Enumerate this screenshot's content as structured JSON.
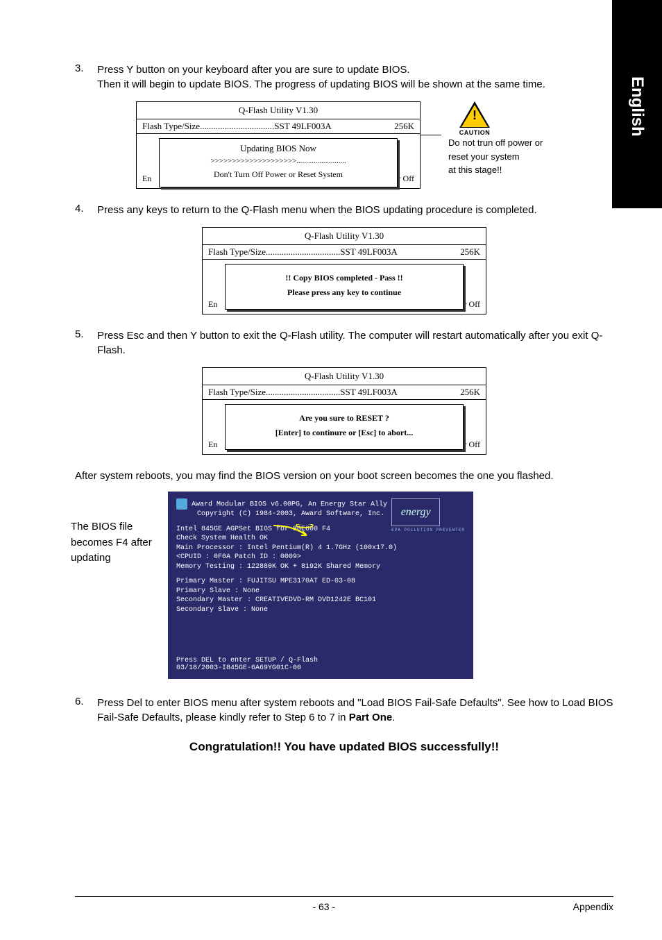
{
  "sideTab": "English",
  "steps": {
    "s3": {
      "num": "3.",
      "text1": "Press Y button on your keyboard after you are sure to update BIOS.",
      "text2": "Then it will begin to update BIOS. The progress of updating BIOS will be shown at the same time."
    },
    "s4": {
      "num": "4.",
      "text": "Press any keys to return to the Q-Flash menu when the BIOS updating procedure is completed."
    },
    "s5": {
      "num": "5.",
      "text": "Press Esc and then Y button to exit the Q-Flash utility. The computer will restart automatically after you exit Q-Flash."
    },
    "s6": {
      "num": "6.",
      "text1": "Press Del to enter BIOS menu after system reboots and \"Load BIOS Fail-Safe Defaults\". See how to Load BIOS Fail-Safe Defaults, please kindly refer to Step 6 to 7 in ",
      "partOne": "Part One",
      "tail": "."
    }
  },
  "qflash": {
    "title": "Q-Flash Utility V1.30",
    "flashTypePrefix": "Flash Type/Size",
    "flashTypeValue": "SST 49LF003A",
    "flashSize": "256K",
    "behindLeft": "En",
    "behindRight": "er Off"
  },
  "popup1": {
    "title": "Updating BIOS Now",
    "progress": ">>>>>>>>>>>>>>>>>>>>..........................",
    "msg": "Don't Turn Off Power or Reset System"
  },
  "popup2": {
    "line1": "!! Copy BIOS completed - Pass !!",
    "line2": "Please press any key to continue"
  },
  "popup3": {
    "line1": "Are you sure to RESET ?",
    "line2": "[Enter] to continure or [Esc] to abort..."
  },
  "caution": {
    "label": "CAUTION",
    "note1": "Do not trun off power or",
    "note2": "reset your system",
    "note3": "at this stage!!"
  },
  "afterReboot": "After system reboots, you may find the BIOS version on your boot screen becomes the one you flashed.",
  "bootLabel": "The BIOS file becomes F4 after updating",
  "boot": {
    "l1": "Award Modular BIOS v6.00PG, An Energy Star Ally",
    "l2": "Copyright  (C) 1984-2003, Award Software,  Inc.",
    "l3a": "Intel 845GE AGPSet BIOS ",
    "l3b": "for 8GE800 F4",
    "l4": "Check System Health OK",
    "l5": "Main Processor : Intel Pentium(R) 4  1.7GHz (100x17.0)",
    "l6": "<CPUID : 0F0A Patch ID  : 0009>",
    "l7": "Memory Testing   : 122880K OK + 8192K Shared Memory",
    "l8": "Primary Master : FUJITSU MPE3170AT ED-03-08",
    "l9": "Primary Slave : None",
    "l10": "Secondary Master : CREATIVEDVD-RM DVD1242E BC101",
    "l11": "Secondary Slave : None",
    "b1": "Press DEL to enter SETUP / Q-Flash",
    "b2": "03/18/2003-I845GE-6A69YG01C-00",
    "energySub": "EPA  POLLUTION  PREVENTER",
    "energyWord": "energy"
  },
  "congrats": "Congratulation!! You have updated BIOS successfully!!",
  "footer": {
    "page": "- 63 -",
    "section": "Appendix"
  }
}
